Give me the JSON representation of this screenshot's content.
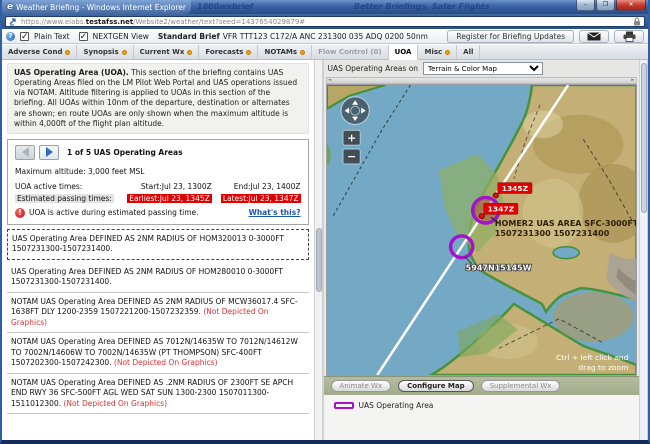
{
  "window": {
    "title": "Weather Briefing - Windows Internet Explorer",
    "watermark_left": "1800wxbrief",
    "watermark_right": "Better Briefings, Safer Flights",
    "url_prefix": "https://www.elabs.",
    "url_domain": "testafss.net",
    "url_path": "/Website2/weather/text?seed=1437654029879#",
    "minimize": "–",
    "maximize": "❐",
    "close": "✕"
  },
  "toolbar": {
    "info_glyph": "?",
    "plain_text_label": "Plain Text",
    "nextgen_label": "NEXTGEN View",
    "brief_type": "Standard Brief",
    "brief_details": "VFR TTT123 C172/A ANC 231300 035 ADQ 0200 50nm",
    "register_button": "Register for Briefing Updates"
  },
  "tabs": [
    {
      "label": "Adverse Cond"
    },
    {
      "label": "Synopsis"
    },
    {
      "label": "Current Wx"
    },
    {
      "label": "Forecasts"
    },
    {
      "label": "NOTAMs"
    },
    {
      "label": "Flow Control (0)"
    },
    {
      "label": "UOA"
    },
    {
      "label": "Misc"
    },
    {
      "label": "All"
    }
  ],
  "briefing": {
    "intro_title": "UAS Operating Area (UOA).",
    "intro_text": " This section of the briefing contains UAS Operating Areas filed on the LM Pilot Web Portal and UAS operations issued via NOTAM. Altitude filtering is applied to UOAs in this section of the briefing. All UOAs within 10nm of the departure, destination or alternates are shown; en route UOAs are only shown when the maximum altitude is within 4,000ft of the flight plan altitude.",
    "pager_label": "1 of 5 UAS Operating Areas",
    "max_altitude": "Maximum altitude: 3,000 feet MSL",
    "active_times_label": "UOA active times:",
    "start": "Start:Jul 23, 1300Z",
    "end": "End:Jul 23, 1400Z",
    "passing_times_label": "Estimated passing times:",
    "earliest": "Earliest:Jul 23, 1345Z",
    "latest": "Latest:Jul 23, 1347Z",
    "warning_glyph": "!",
    "warning": "UOA is active during estimated passing time.",
    "whats_this": "What's this?"
  },
  "uoa_list": [
    {
      "text": "UAS Operating Area DEFINED AS 2NM RADIUS OF HOM320013 0-3000FT 1507231300-1507231400.",
      "note": ""
    },
    {
      "text": "UAS Operating Area DEFINED AS 2NM RADIUS OF HOM280010 0-3000FT 1507231300-1507231400.",
      "note": ""
    },
    {
      "text": "NOTAM UAS Operating Area DEFINED AS 2NM RADIUS OF MCW36017.4 SFC-1638FT DLY 1200-2359 1507221200-1507232359. ",
      "note": "(Not Depicted On Graphics)"
    },
    {
      "text": "NOTAM UAS Operating Area DEFINED AS 7012N/14635W TO 7012N/14612W TO 7002N/14606W TO 7002N/14635W (PT THOMPSON) SFC-400FT 1507202300-1507242300. ",
      "note": "(Not Depicted On Graphics)"
    },
    {
      "text": "NOTAM UAS Operating Area DEFINED AS .2NM RADIUS OF 2300FT SE APCH END RWY 36 SFC-500FT AGL WED SAT SUN 1300-2300 1507011300-1511012300. ",
      "note": "(Not Depicted On Graphics)"
    }
  ],
  "map": {
    "header_label": "UAS Operating Areas on",
    "layer_select": "Terrain & Color Map",
    "marker1_time": "1345Z",
    "marker2_time": "1347Z",
    "area_label_line1": "HOMER2 UAS AREA SFC-3000FT",
    "area_label_line2": "1507231300 1507231400",
    "waypoint_label": "5947N15145W",
    "zoom_hint_line1": "Ctrl + left click and",
    "zoom_hint_line2": "drag to zoom",
    "zoom_in_glyph": "+",
    "zoom_out_glyph": "−",
    "buttons": {
      "animate": "Animate Wx",
      "configure": "Configure Map",
      "supplemental": "Supplemental Wx"
    },
    "legend_label": "UAS Operating Area"
  },
  "theme": {
    "uoa-purple": "#a312cc",
    "alert-red": "#e20000",
    "tab-dot": "#f0a500",
    "link-blue": "#1a56b0",
    "water": "#74a9c6"
  }
}
